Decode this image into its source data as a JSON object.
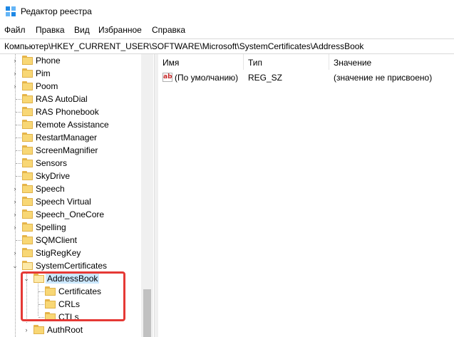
{
  "window": {
    "title": "Редактор реестра"
  },
  "menu": [
    "Файл",
    "Правка",
    "Вид",
    "Избранное",
    "Справка"
  ],
  "address": "Компьютер\\HKEY_CURRENT_USER\\SOFTWARE\\Microsoft\\SystemCertificates\\AddressBook",
  "tree": {
    "items": [
      "Phone",
      "Pim",
      "Poom",
      "RAS AutoDial",
      "RAS Phonebook",
      "Remote Assistance",
      "RestartManager",
      "ScreenMagnifier",
      "Sensors",
      "SkyDrive",
      "Speech",
      "Speech Virtual",
      "Speech_OneCore",
      "Spelling",
      "SQMClient",
      "StigRegKey",
      "SystemCertificates"
    ],
    "selected": "AddressBook",
    "children": [
      "Certificates",
      "CRLs",
      "CTLs"
    ],
    "next": "AuthRoot"
  },
  "values": {
    "headers": {
      "name": "Имя",
      "type": "Тип",
      "data": "Значение"
    },
    "rows": [
      {
        "icon": "ab",
        "name": "(По умолчанию)",
        "type": "REG_SZ",
        "data": "(значение не присвоено)"
      }
    ]
  },
  "colors": {
    "selection": "#cce8ff",
    "highlight": "#e53935",
    "folder": "#f8d775"
  }
}
